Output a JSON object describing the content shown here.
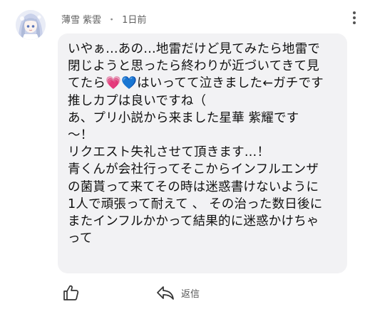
{
  "comment": {
    "avatar_icon": "anime-girl-avatar",
    "author": "薄雪 紫雲",
    "separator": "・",
    "timestamp": "1日前",
    "menu_icon": "kebab-menu-icon",
    "lines": [
      "いやぁ…あの…地雷だけど見てみたら地雷で",
      "閉じようと思ったら終わりが近づいてきて見",
      "てたら💗💙はいってて泣きました←ガチです",
      "推しカプは良いですね（",
      "あ、プリ小説から来ました星華 紫耀です",
      "～！",
      "リクエスト失礼させて頂きます…！",
      "青くんが会社行ってそこからインフルエンザ",
      "の菌貰って来てその時は迷惑書けないように",
      "1人で頑張って耐えて 、 その治った数日後に",
      "またインフルかかって結果的に迷惑かけちゃ",
      "って"
    ]
  },
  "actions": {
    "like_icon": "thumbs-up-icon",
    "reply_icon": "reply-arrow-icon",
    "reply_label": "返信"
  },
  "colors": {
    "bubble_background": "#f2f2f4",
    "text": "#111111",
    "meta_text": "#5f5f5f"
  }
}
